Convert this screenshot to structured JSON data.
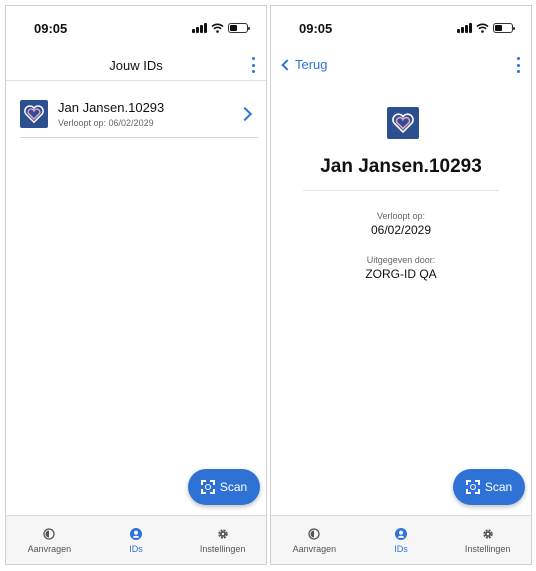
{
  "colors": {
    "accent": "#2f72d6",
    "logo_background": "#2b4f8f",
    "tab_bar_background": "#f6f6f6"
  },
  "status_bar": {
    "time": "09:05",
    "icons": [
      "cellular-signal-icon",
      "wifi-icon",
      "battery-icon"
    ]
  },
  "list_screen": {
    "title": "Jouw IDs",
    "items": [
      {
        "icon": "heart-logo-icon",
        "name": "Jan Jansen.10293",
        "expiry": "Verloopt op: 06/02/2029"
      }
    ]
  },
  "detail_screen": {
    "back_label": "Terug",
    "name": "Jan Jansen.10293",
    "fields": [
      {
        "label": "Verloopt op:",
        "value": "06/02/2029"
      },
      {
        "label": "Uitgegeven door:",
        "value": "ZORG-ID QA"
      }
    ]
  },
  "fab": {
    "label": "Scan",
    "icon": "scan-icon"
  },
  "tab_bar": {
    "active": "IDs",
    "tabs": [
      {
        "label": "Aanvragen",
        "icon": "requests-icon"
      },
      {
        "label": "IDs",
        "icon": "user-icon"
      },
      {
        "label": "Instellingen",
        "icon": "gear-icon"
      }
    ]
  }
}
